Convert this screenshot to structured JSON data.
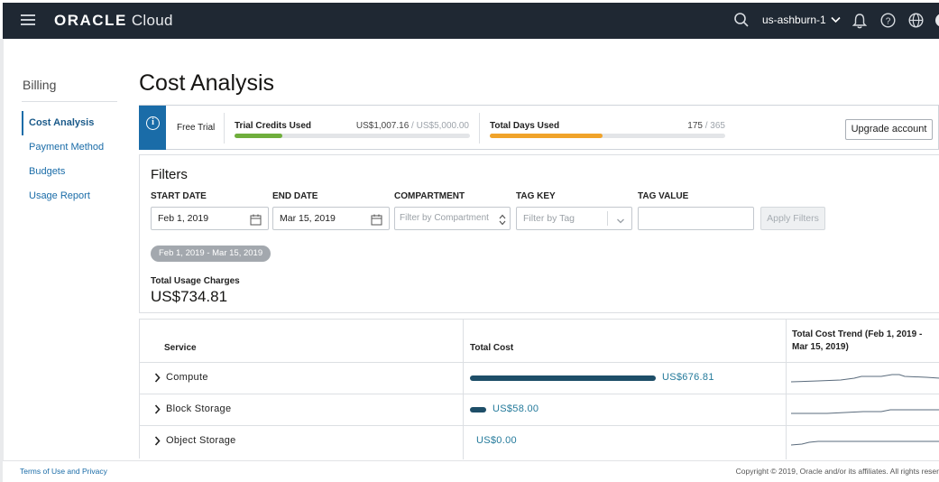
{
  "topbar": {
    "logo_brand": "ORACLE",
    "logo_product": "Cloud",
    "region": "us-ashburn-1"
  },
  "sidebar": {
    "title": "Billing",
    "items": [
      {
        "label": "Cost Analysis",
        "active": true
      },
      {
        "label": "Payment Method",
        "active": false
      },
      {
        "label": "Budgets",
        "active": false
      },
      {
        "label": "Usage Report",
        "active": false
      }
    ]
  },
  "page": {
    "title": "Cost Analysis"
  },
  "trial": {
    "free_label": "Free Trial",
    "credits": {
      "label": "Trial Credits Used",
      "used": "US$1,007.16",
      "total": " / US$5,000.00",
      "fraction": 0.2014,
      "color": "#6fae3c"
    },
    "days": {
      "label": "Total Days Used",
      "used": "175",
      "total": " / 365",
      "fraction": 0.4795,
      "color": "#f0a32a"
    },
    "upgrade_label": "Upgrade account"
  },
  "filters": {
    "heading": "Filters",
    "start_date": {
      "label": "START DATE",
      "value": "Feb 1, 2019"
    },
    "end_date": {
      "label": "END DATE",
      "value": "Mar 15, 2019"
    },
    "compartment": {
      "label": "COMPARTMENT",
      "placeholder": "Filter by Compartment"
    },
    "tag_key": {
      "label": "TAG KEY",
      "placeholder": "Filter by Tag"
    },
    "tag_value": {
      "label": "TAG VALUE",
      "value": ""
    },
    "apply_label": "Apply Filters",
    "chip": "Feb 1, 2019 - Mar 15, 2019",
    "total_label": "Total Usage Charges",
    "total_value": "US$734.81"
  },
  "table": {
    "headers": {
      "service": "Service",
      "cost": "Total Cost",
      "trend_line1": "Total Cost Trend (Feb 1, 2019 -",
      "trend_line2": "Mar 15, 2019)"
    },
    "rows": [
      {
        "service": "Compute",
        "cost": "US$676.81",
        "amount": 676.81
      },
      {
        "service": "Block Storage",
        "cost": "US$58.00",
        "amount": 58.0
      },
      {
        "service": "Object Storage",
        "cost": "US$0.00",
        "amount": 0.0
      }
    ]
  },
  "footer": {
    "left": "Terms of Use and Privacy",
    "right": "Copyright © 2019, Oracle and/or its affiliates. All rights reser"
  }
}
